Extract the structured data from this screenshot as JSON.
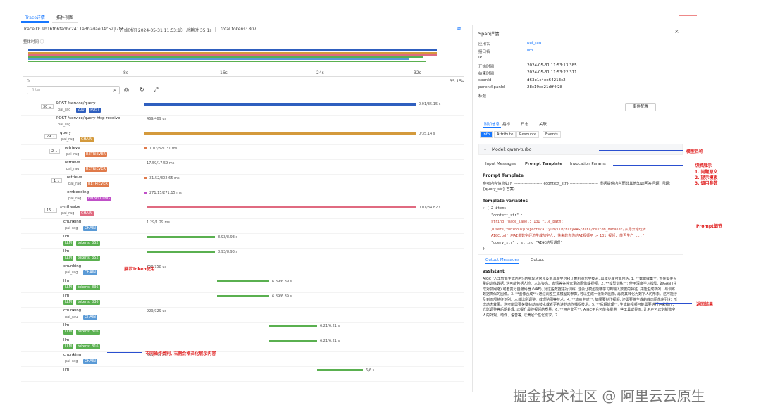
{
  "tabs": [
    "Trace详情",
    "拓扑视图"
  ],
  "meta": {
    "trace_id": "TraceID: 9b16fb6fadbc2411a3b2dae04c5217f2",
    "start": "开始时间  2024-05-31 11:53:13",
    "total": "总耗时  35.1s",
    "tokens": "total tokens: 807"
  },
  "overview_label": "整体时间 ⓘ",
  "ruler": [
    "0",
    "8s",
    "16s",
    "24s",
    "32s",
    "35.15s"
  ],
  "filter_placeholder": "filter",
  "rows": [
    {
      "name": "POST /service/query",
      "svc": "pai_rag",
      "count": "30",
      "tags": [
        [
          "200",
          "#2f5fbf"
        ],
        [
          "POST",
          "#2f5fbf"
        ]
      ],
      "dur": "0.01/35.15 s"
    },
    {
      "name": "POST /service/query http receive",
      "svc": "pai_rag",
      "count": "",
      "tags": [],
      "dur": "469/469 us"
    },
    {
      "name": "query",
      "svc": "pai_rag",
      "count": "29",
      "tags": [
        [
          "CHAIN",
          "#d49a3c"
        ]
      ],
      "dur": "0/35.14 s"
    },
    {
      "name": "retrieve",
      "svc": "pai_rag",
      "count": "2",
      "tags": [
        [
          "RETRIEVER",
          "#e07a4a"
        ]
      ],
      "dur": "1.07/321.31 ms"
    },
    {
      "name": "retrieve",
      "svc": "pai_rag",
      "count": "",
      "tags": [
        [
          "RETRIEVER",
          "#e07a4a"
        ]
      ],
      "dur": "17.59/17.59 ms"
    },
    {
      "name": "retrieve",
      "svc": "pai_rag",
      "count": "1",
      "tags": [
        [
          "RETRIEVER",
          "#e07a4a"
        ]
      ],
      "dur": "31.52/302.65 ms"
    },
    {
      "name": "embedding",
      "svc": "pai_rag",
      "count": "",
      "tags": [
        [
          "EMBEDDING",
          "#c050c8"
        ]
      ],
      "dur": "271.15/271.15 ms"
    },
    {
      "name": "synthesize",
      "svc": "pai_rag",
      "count": "15",
      "tags": [
        [
          "CHAIN",
          "#e06a80"
        ]
      ],
      "dur": "0.01/34.82 s"
    },
    {
      "name": "chunking",
      "svc": "pai_rag",
      "count": "",
      "tags": [
        [
          "CHAIN",
          "#5a9ad6"
        ]
      ],
      "dur": "1.29/1.29 ms"
    },
    {
      "name": "llm",
      "svc": "",
      "count": "",
      "tags": [
        [
          "LLM",
          "#5ab050"
        ],
        [
          "tokens: 352",
          "#5ab050"
        ]
      ],
      "dur": "8.93/8.93 s"
    },
    {
      "name": "llm",
      "svc": "",
      "count": "",
      "tags": [
        [
          "LLM",
          "#5ab050"
        ],
        [
          "tokens: 352",
          "#5ab050"
        ]
      ],
      "dur": "8.93/8.93 s"
    },
    {
      "name": "chunking",
      "svc": "pai_rag",
      "count": "",
      "tags": [
        [
          "CHAIN",
          "#5a9ad6"
        ]
      ],
      "dur": "758/758 us"
    },
    {
      "name": "llm",
      "svc": "",
      "count": "",
      "tags": [
        [
          "LLM",
          "#5ab050"
        ],
        [
          "tokens: 836",
          "#5ab050"
        ]
      ],
      "dur": "6.89/6.89 s"
    },
    {
      "name": "llm",
      "svc": "",
      "count": "",
      "tags": [
        [
          "LLM",
          "#5ab050"
        ],
        [
          "tokens: 836",
          "#5ab050"
        ]
      ],
      "dur": "6.89/6.89 s"
    },
    {
      "name": "chunking",
      "svc": "pai_rag",
      "count": "",
      "tags": [
        [
          "CHAIN",
          "#5a9ad6"
        ]
      ],
      "dur": "929/929 us"
    },
    {
      "name": "llm",
      "svc": "",
      "count": "",
      "tags": [
        [
          "LLM",
          "#5ab050"
        ],
        [
          "tokens: 816",
          "#5ab050"
        ]
      ],
      "dur": "6.21/6.21 s"
    },
    {
      "name": "llm",
      "svc": "",
      "count": "",
      "tags": [
        [
          "LLM",
          "#5ab050"
        ],
        [
          "tokens: 816",
          "#5ab050"
        ]
      ],
      "dur": "6.21/6.21 s"
    },
    {
      "name": "chunking",
      "svc": "pai_rag",
      "count": "",
      "tags": [
        [
          "CHAIN",
          "#5a9ad6"
        ]
      ],
      "dur": "359/359 us"
    },
    {
      "name": "llm",
      "svc": "",
      "count": "",
      "tags": [],
      "dur": "6/6 s"
    }
  ],
  "panel": {
    "title": "Span详情",
    "kv": [
      [
        "应用名",
        "pai_rag"
      ],
      [
        "接口名",
        "llm"
      ],
      [
        "IP",
        ""
      ],
      [
        "开始时间",
        "2024-05-31 11:53:13.385"
      ],
      [
        "结束时间",
        "2024-05-31 11:53:22.311"
      ],
      [
        "spanId",
        "d63e1c4ee64213c2"
      ],
      [
        "parentSpanId",
        "28c19cd21dff4f28"
      ],
      [
        "标题",
        ""
      ]
    ],
    "event_btn": "事件配置",
    "subtabs": [
      "附加信息",
      "指标",
      "日志",
      "关联"
    ],
    "info_tabs": [
      "Info",
      "Attribute",
      "Resource",
      "Events"
    ],
    "model": "Model: qwen-turbo",
    "msg_tabs": [
      "Input Messages",
      "Prompt Template",
      "Invocation Params"
    ],
    "pt_title": "Prompt Template",
    "pt_text": "参考内容信息如下 --------------------- {context_str} --------------------- 根据提供内容而非其他知识回答问题: 问题: {query_str} 答案:",
    "tv_title": "Template variables",
    "tv_lines": [
      "▾ {  2 items",
      "\"context_str\" :",
      "string \"page_label: 131 file_path:",
      "/Users/xunzhou/projects/aliyun/llm/EasyRAG/data/custom_dataset/从零开始玩转",
      "AIGC.pdf 用AI做数字经济生成加字人, 快来教你你的AI视频吧 > 131 视频, 能否生产 ...\"",
      "\"query_str\" : string \"AIGC的所谓理\"",
      "}"
    ],
    "out_tabs": [
      "Output Messages",
      "Output"
    ],
    "out_role": "assistant",
    "out_text": "AIGC (人工智能生成内容) 的实现通常涉及到深度学习和计算机图形学技术, 具体步骤可能包括: 1. **数据收集**: 首先需要大量的训练数据, 这可能包括人脸、人体姿态、表情等各种元素的图像或视频。2. **模型训练**: 使用深度学习模型, 如GAN (生成对抗网络) 或者变分自编码器 (VAE), 对这些数据进行训练, 这会让模型能够学习到输入数据的特征, 并能生成新的、与训练数据类似的图像。3. **图像合成**: 通过调整生成模型的参数, 可以生成一张新的图像, 再将其转化为数字人的形象。这可能涉及到面部特征识别、人体比例调整、纹理贴图等技术。4. **动画生成**: 如果要制作视频, 还需要将生成的静态图像序列化, 形成动态效果。这可能需要关键帧动画技术或者更先进的动作捕捉技术。5. **后期处理**: 生成的视频可能需要进行色彩校正、光影调整等后期处理, 以提升最终视频的质量。6. **用户交互**: AIGC平台可能会提供一些工具或界面, 让用户可以定制数字人的外观、动作、语音等, 以满足个性化需求。7"
  },
  "annotations": {
    "token": "展示Token使用",
    "types": "不同操作类别, 右侧会格式化展示内容",
    "model": "模型名称",
    "switch": "切换展示",
    "switch_list": [
      "1. 问题原文",
      "2. 提示模板",
      "3. 调用参数"
    ],
    "prompt": "Prompt细节",
    "result": "返回结果"
  },
  "watermark": "掘金技术社区 @ 阿里云云原生",
  "colors": {
    "accent": "#1677ff",
    "annot": "#e02020",
    "arrow": "#2a4fd0"
  }
}
